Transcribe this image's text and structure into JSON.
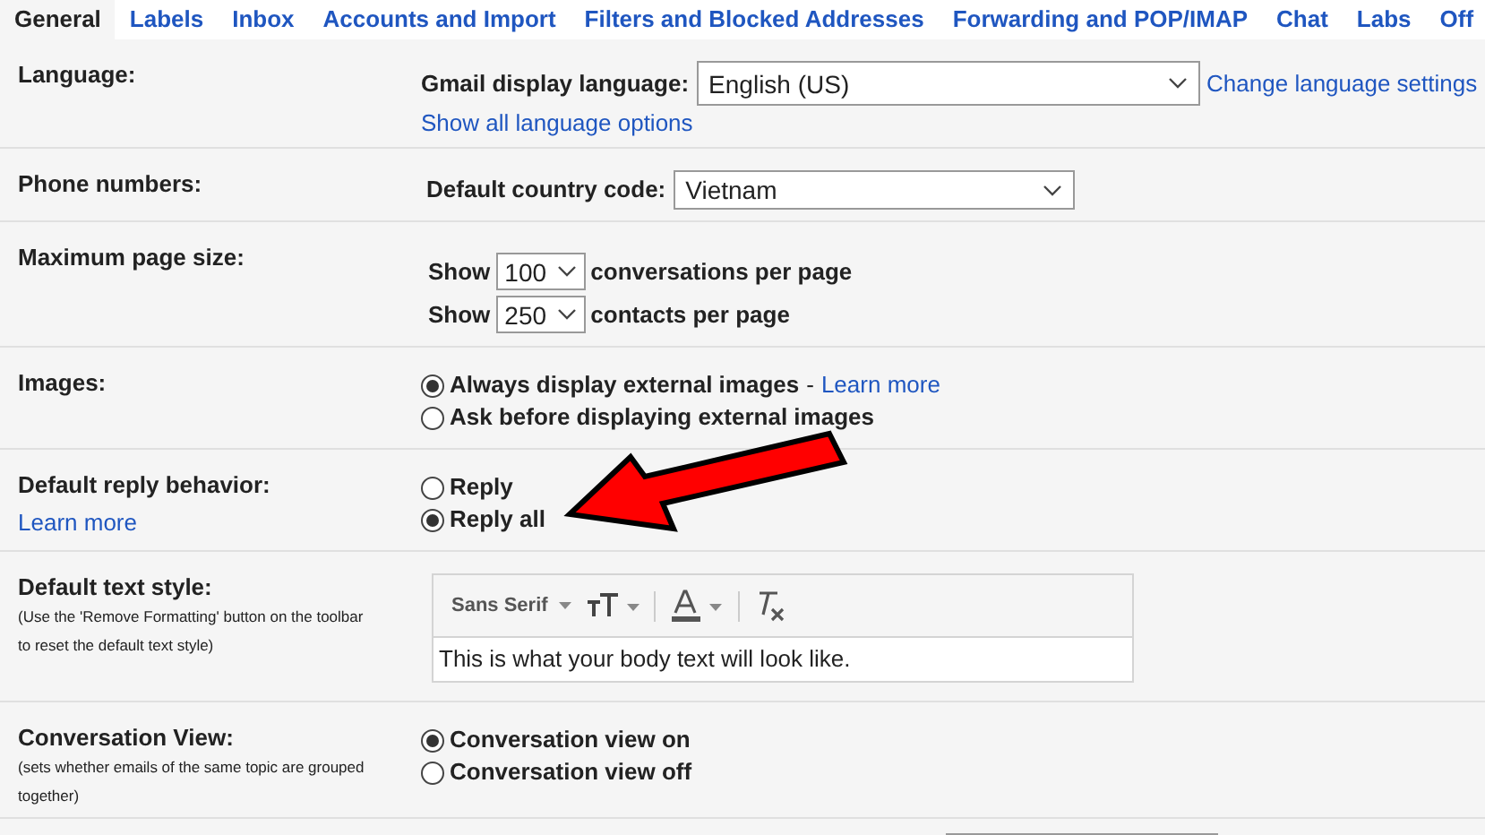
{
  "tabs": [
    {
      "label": "General",
      "selected": true
    },
    {
      "label": "Labels",
      "selected": false
    },
    {
      "label": "Inbox",
      "selected": false
    },
    {
      "label": "Accounts and Import",
      "selected": false
    },
    {
      "label": "Filters and Blocked Addresses",
      "selected": false
    },
    {
      "label": "Forwarding and POP/IMAP",
      "selected": false
    },
    {
      "label": "Chat",
      "selected": false
    },
    {
      "label": "Labs",
      "selected": false
    },
    {
      "label": "Off",
      "selected": false
    }
  ],
  "sections": [
    {
      "label": "Language:",
      "items": [
        {
          "kind": "select",
          "label": "Gmail display language:",
          "value": "English (US)",
          "link": "Change language settings"
        },
        {
          "kind": "link",
          "text": "Show all language options"
        }
      ]
    },
    {
      "label": "Phone numbers:",
      "items": [
        {
          "kind": "select",
          "label": "Default country code:",
          "value": "Vietnam"
        }
      ]
    },
    {
      "label": "Maximum page size:",
      "items": [
        {
          "kind": "show",
          "prefix": "Show",
          "value": "100",
          "suffix": "conversations per page"
        },
        {
          "kind": "show",
          "prefix": "Show",
          "value": "250",
          "suffix": "contacts per page"
        }
      ]
    },
    {
      "label": "Images:",
      "items": [
        {
          "kind": "radio",
          "label": "Always display external images",
          "selected": true,
          "separator": "-",
          "link": "Learn more"
        },
        {
          "kind": "radio",
          "label": "Ask before displaying external images",
          "selected": false
        }
      ]
    },
    {
      "label": "Default reply behavior:",
      "link": "Learn more",
      "items": [
        {
          "kind": "radio",
          "label": "Reply",
          "selected": false
        },
        {
          "kind": "radio",
          "label": "Reply all",
          "selected": true
        }
      ]
    },
    {
      "label": "Default text style:",
      "note": "(Use the 'Remove Formatting' button on the toolbar to reset the default text style)",
      "items": [
        {
          "kind": "editor",
          "font": "Sans Serif",
          "sample": "This is what your body text will look like."
        }
      ]
    },
    {
      "label": "Conversation View:",
      "note": "(sets whether emails of the same topic are grouped together)",
      "items": [
        {
          "kind": "radio",
          "label": "Conversation view on",
          "selected": true
        },
        {
          "kind": "radio",
          "label": "Conversation view off",
          "selected": false
        }
      ]
    },
    {
      "items": [
        {
          "kind": "partial_select"
        }
      ]
    }
  ]
}
